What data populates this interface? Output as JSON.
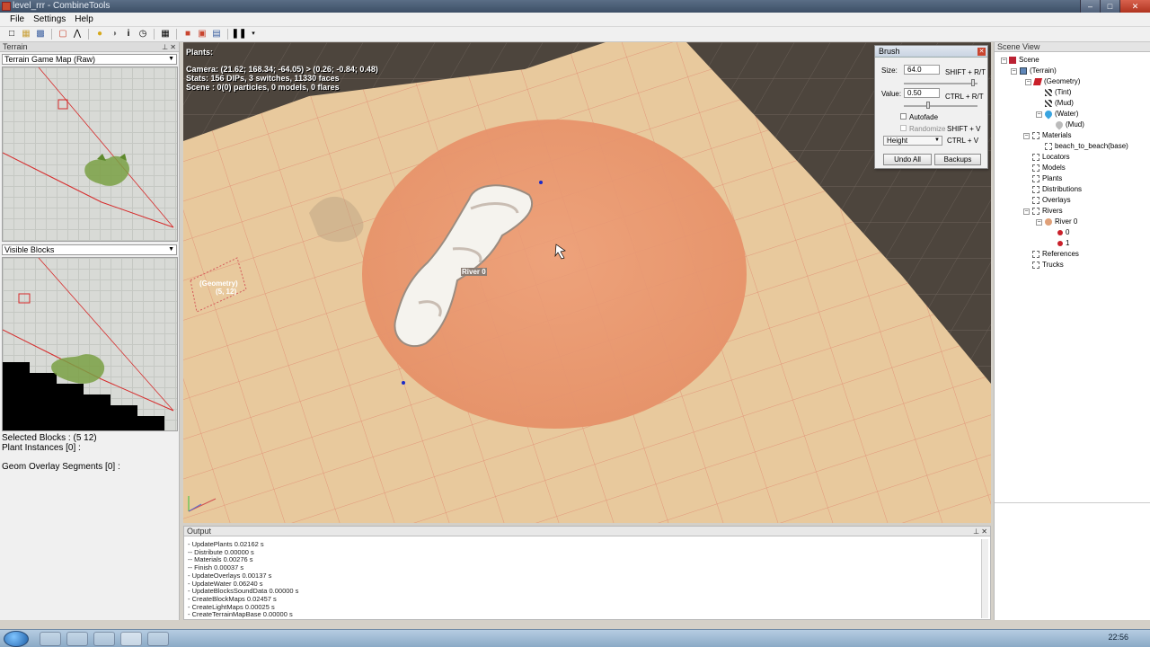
{
  "window": {
    "title": "level_rrr - CombineTools"
  },
  "menu": [
    "File",
    "Settings",
    "Help"
  ],
  "toolbar_icons": [
    "new-icon",
    "open-icon",
    "save-icon",
    "sep",
    "box-icon",
    "axis-icon",
    "sep",
    "bulb-icon",
    "sphere-icon",
    "info-icon",
    "clock-icon",
    "sep",
    "grid-icon",
    "sep",
    "red-cube-icon",
    "image-icon",
    "layers-icon",
    "sep",
    "pause-icon",
    "dropdown-icon"
  ],
  "left": {
    "header": "Terrain",
    "map_select": "Terrain Game Map (Raw)",
    "blocks_select": "Visible Blocks",
    "selected_blocks": "Selected Blocks : (5 12)",
    "plant_instances": "Plant Instances [0] :",
    "geom_segments": "Geom Overlay Segments [0] :"
  },
  "viewport": {
    "header": "Plants:",
    "camera": "Camera: (21.62; 168.34; -64.05) > (0.26; -0.84; 0.48)",
    "stats": "Stats: 156 DIPs, 3 switches, 11330 faces",
    "scene": "Scene : 0(0) particles, 0 models, 0 flares",
    "river_label": "River 0",
    "geom_label": "(Geometry)",
    "geom_coords": "(5, 12)"
  },
  "brush": {
    "title": "Brush",
    "size_label": "Size:",
    "size_value": "64.0",
    "size_shortcut": "SHIFT + R/T",
    "value_label": "Value:",
    "value_value": "0.50",
    "value_shortcut": "CTRL + R/T",
    "autofade": "Autofade",
    "randomize": "Randomize",
    "randomize_shortcut": "SHIFT + V",
    "mode": "Height",
    "mode_shortcut": "CTRL + V",
    "undo_all": "Undo All",
    "backups": "Backups",
    "size_fraction": 0.9,
    "value_fraction": 0.5
  },
  "scene_view": {
    "header": "Scene View",
    "items": [
      {
        "label": "Scene",
        "icon": "scene-icon"
      },
      {
        "label": "(Terrain)",
        "icon": "terrain-icon"
      },
      {
        "label": "(Geometry)",
        "icon": "geometry-icon"
      },
      {
        "label": "(Tint)",
        "icon": "tint-icon"
      },
      {
        "label": "(Mud)",
        "icon": "mud-icon"
      },
      {
        "label": "(Water)",
        "icon": "water-icon"
      },
      {
        "label": "(Mud)",
        "icon": "drop-icon"
      },
      {
        "label": "Materials",
        "icon": "folder-icon"
      },
      {
        "label": "beach_to_beach(base)",
        "icon": ""
      },
      {
        "label": "Locators",
        "icon": "folder-icon"
      },
      {
        "label": "Models",
        "icon": "folder-icon"
      },
      {
        "label": "Plants",
        "icon": "folder-icon"
      },
      {
        "label": "Distributions",
        "icon": "folder-icon"
      },
      {
        "label": "Overlays",
        "icon": "folder-icon"
      },
      {
        "label": "Rivers",
        "icon": "folder-icon"
      },
      {
        "label": "River 0",
        "icon": "river-icon"
      },
      {
        "label": "0",
        "icon": "point-icon"
      },
      {
        "label": "1",
        "icon": "point-icon"
      },
      {
        "label": "References",
        "icon": "folder-icon"
      },
      {
        "label": "Trucks",
        "icon": "folder-icon"
      }
    ]
  },
  "output": {
    "header": "Output",
    "lines": [
      "- UpdatePlants 0.02162 s",
      "-- Distribute 0.00000 s",
      "-- Materials 0.00276 s",
      "-- Finish 0.00037 s",
      "- UpdateOverlays 0.00137 s",
      "- UpdateWater 0.06240 s",
      "- UpdateBlocksSoundData 0.00000 s",
      "- CreateBlockMaps 0.02457 s",
      "- CreateLightMaps 0.00025 s",
      "- CreateTerrainMapBase 0.00000 s"
    ]
  },
  "taskbar": {
    "clock": "22:56"
  },
  "colors": {
    "terrain": "#e7c9a0",
    "brush": "#e8946a",
    "grid_line": "#d9826a",
    "accent": "#c9452f"
  }
}
